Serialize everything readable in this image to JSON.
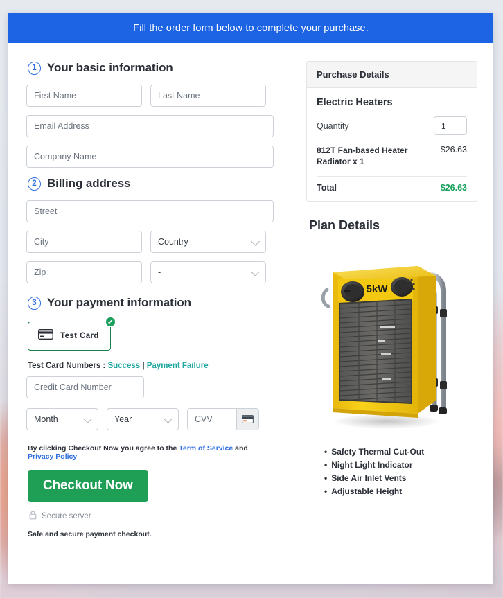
{
  "banner": {
    "text": "Fill the order form below to complete your purchase."
  },
  "sections": {
    "basic": {
      "num": "1",
      "title": "Your basic information"
    },
    "billing": {
      "num": "2",
      "title": "Billing address"
    },
    "payment": {
      "num": "3",
      "title": "Your payment information"
    }
  },
  "fields": {
    "first_name": {
      "placeholder": "First Name",
      "value": ""
    },
    "last_name": {
      "placeholder": "Last Name",
      "value": ""
    },
    "email": {
      "placeholder": "Email Address",
      "value": ""
    },
    "company": {
      "placeholder": "Company Name",
      "value": ""
    },
    "street": {
      "placeholder": "Street",
      "value": ""
    },
    "city": {
      "placeholder": "City",
      "value": ""
    },
    "country": {
      "selected": "Country"
    },
    "zip": {
      "placeholder": "Zip",
      "value": ""
    },
    "state": {
      "selected": "-"
    },
    "card_number": {
      "placeholder": "Credit Card Number",
      "value": ""
    },
    "month": {
      "selected": "Month"
    },
    "year": {
      "selected": "Year"
    },
    "cvv": {
      "placeholder": "CVV",
      "value": ""
    }
  },
  "payment": {
    "method_label": "Test Card",
    "method_icon": "credit-card-icon",
    "selected_badge": "✔",
    "test_numbers_prefix": "Test Card Numbers : ",
    "link_success": "Success",
    "separator": " | ",
    "link_failure": "Payment Failure"
  },
  "terms": {
    "prefix": "By clicking Checkout Now you agree to the ",
    "tos": "Term of Service",
    "middle": " and ",
    "privacy": "Privacy Policy"
  },
  "checkout": {
    "button_label": "Checkout Now",
    "secure_icon": "lock-icon",
    "secure_label": "Secure server",
    "safe_note": "Safe and secure payment checkout."
  },
  "purchase": {
    "header": "Purchase Details",
    "product": "Electric Heaters",
    "quantity_label": "Quantity",
    "quantity_value": "1",
    "line_item_desc": "812T Fan-based Heater Radiator x 1",
    "line_item_price": "$26.63",
    "total_label": "Total",
    "total_value": "$26.63"
  },
  "plan": {
    "title": "Plan Details",
    "product_image_alt": "yellow-industrial-fan-heater",
    "power_label": "5kW",
    "features": [
      "Safety Thermal Cut-Out",
      "Night Light Indicator",
      "Side Air Inlet Vents",
      "Adjustable Height"
    ]
  },
  "colors": {
    "banner_blue": "#1c64e3",
    "accent_blue": "#2f6fe0",
    "success_green": "#18a05c",
    "button_green": "#1f9e56",
    "link_teal": "#1fa6a0",
    "heater_yellow": "#f5cc13"
  }
}
